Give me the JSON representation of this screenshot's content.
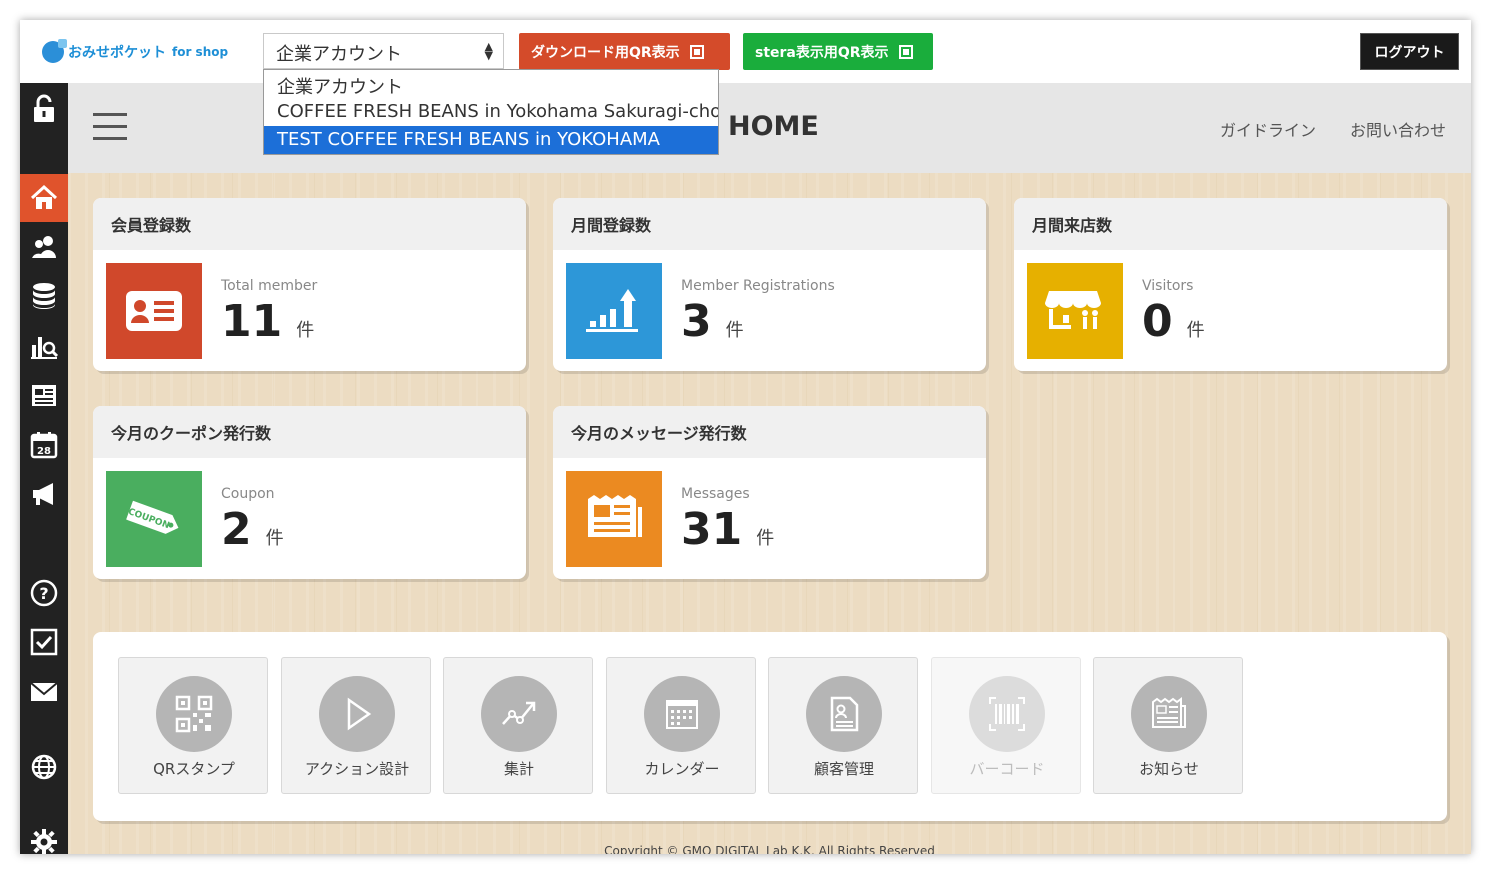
{
  "topbar": {
    "logo_text": "おみせポケット",
    "logo_sub": "for shop",
    "account_select": "企業アカウント",
    "download_qr_label": "ダウンロード用QR表示",
    "stera_qr_label": "stera表示用QR表示",
    "logout_label": "ログアウト"
  },
  "dropdown": {
    "options": [
      "企業アカウント",
      "COFFEE FRESH BEANS in Yokohama Sakuragi-cho",
      "TEST COFFEE FRESH BEANS in YOKOHAMA"
    ],
    "selected_index": 2
  },
  "header": {
    "title": "HOME",
    "guideline_label": "ガイドライン",
    "contact_label": "お問い合わせ"
  },
  "cards": [
    {
      "title": "会員登録数",
      "label": "Total member",
      "value": "11",
      "unit": "件",
      "color": "#d0482b"
    },
    {
      "title": "月間登録数",
      "label": "Member Registrations",
      "value": "3",
      "unit": "件",
      "color": "#2d97d8"
    },
    {
      "title": "月間来店数",
      "label": "Visitors",
      "value": "0",
      "unit": "件",
      "color": "#e6b000"
    },
    {
      "title": "今月のクーポン発行数",
      "label": "Coupon",
      "value": "2",
      "unit": "件",
      "color": "#4aae5f"
    },
    {
      "title": "今月のメッセージ発行数",
      "label": "Messages",
      "value": "31",
      "unit": "件",
      "color": "#eb8a21"
    }
  ],
  "coupon_icon_text": "COUPON",
  "shortcuts": [
    {
      "label": "QRスタンプ",
      "icon": "qr-icon",
      "enabled": true
    },
    {
      "label": "アクション設計",
      "icon": "play-icon",
      "enabled": true
    },
    {
      "label": "集計",
      "icon": "trend-icon",
      "enabled": true
    },
    {
      "label": "カレンダー",
      "icon": "calendar-icon",
      "enabled": true
    },
    {
      "label": "顧客管理",
      "icon": "document-icon",
      "enabled": true
    },
    {
      "label": "バーコード",
      "icon": "barcode-icon",
      "enabled": false
    },
    {
      "label": "お知らせ",
      "icon": "news-icon",
      "enabled": true
    }
  ],
  "sidebar": {
    "items": [
      "unlock-icon",
      "home-icon",
      "users-icon",
      "database-icon",
      "analytics-icon",
      "news-icon",
      "calendar-icon",
      "megaphone-icon",
      "help-icon",
      "checkbox-icon",
      "mail-icon",
      "globe-icon",
      "gear-icon"
    ],
    "active": "home-icon",
    "calendar_day": "28"
  },
  "copyright": "Copyright © GMO DIGITAL Lab K.K. All Rights Reserved",
  "colors": {
    "accent": "#e0532c",
    "download": "#d44b2a",
    "stera": "#1aad3c",
    "selected_option": "#1c6fd8"
  }
}
